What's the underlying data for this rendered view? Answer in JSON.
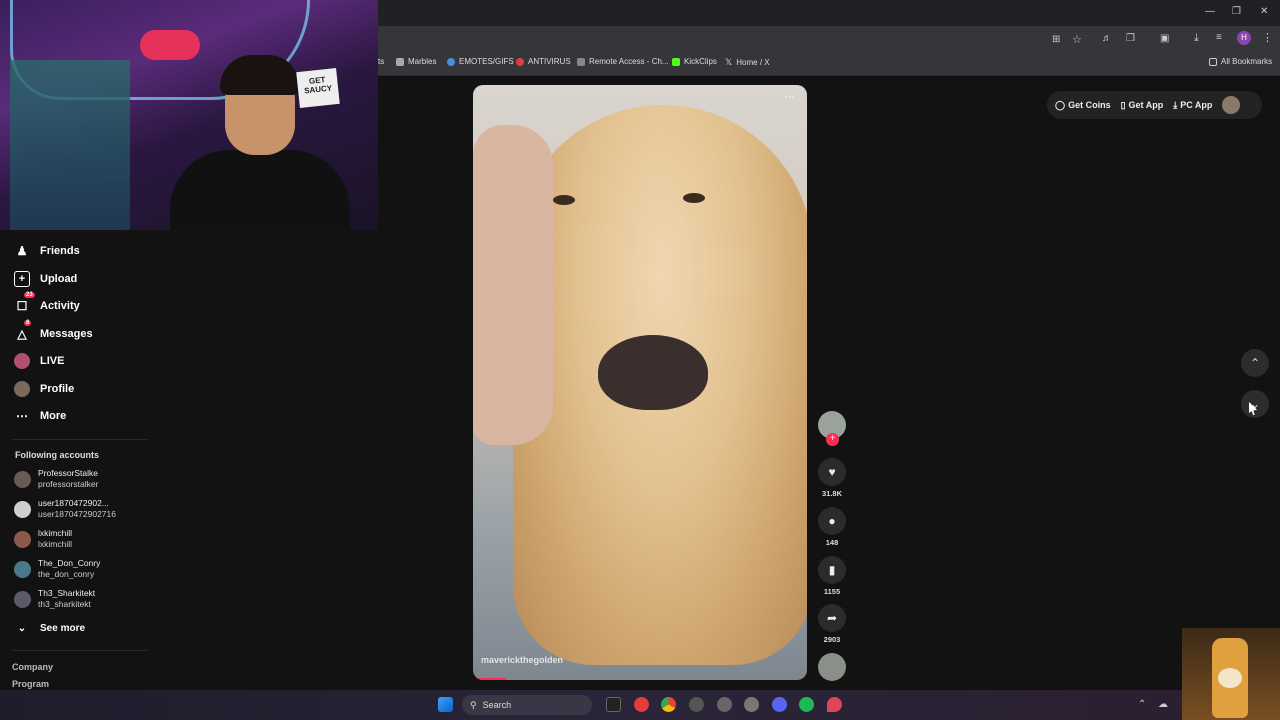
{
  "browser": {
    "bookmarks": [
      {
        "label": "ts",
        "color": "#777"
      },
      {
        "label": "Marbles",
        "color": "#aaa"
      },
      {
        "label": "EMOTES/GIFS",
        "color": "#4a90e2"
      },
      {
        "label": "ANTIVIRUS",
        "color": "#e23c3c"
      },
      {
        "label": "Remote Access - Ch...",
        "color": "#888"
      },
      {
        "label": "KickClips",
        "color": "#53fc18"
      },
      {
        "label": "Home / X",
        "color": "#ddd"
      }
    ],
    "all_bookmarks": "All Bookmarks",
    "profile_initial": "H"
  },
  "webcam": {
    "sign_text": "GET SAUCY"
  },
  "sidebar": {
    "nav": [
      {
        "label": "Friends",
        "icon": "friends-icon",
        "badge": ""
      },
      {
        "label": "Upload",
        "icon": "upload-icon",
        "badge": ""
      },
      {
        "label": "Activity",
        "icon": "activity-icon",
        "badge": "23"
      },
      {
        "label": "Messages",
        "icon": "messages-icon",
        "badge": "8"
      },
      {
        "label": "LIVE",
        "icon": "live-icon",
        "badge": ""
      },
      {
        "label": "Profile",
        "icon": "profile-icon",
        "badge": ""
      },
      {
        "label": "More",
        "icon": "more-icon",
        "badge": ""
      }
    ],
    "following_title": "Following accounts",
    "following": [
      {
        "name": "ProfessorStalke",
        "username": "professorstalker"
      },
      {
        "name": "user1870472902...",
        "username": "user1870472902716"
      },
      {
        "name": "lxkimchill",
        "username": "lxkimchill"
      },
      {
        "name": "The_Don_Conry",
        "username": "the_don_conry"
      },
      {
        "name": "Th3_Sharkitekt",
        "username": "th3_sharkitekt"
      }
    ],
    "see_more": "See more",
    "footer": [
      "Company",
      "Program"
    ]
  },
  "video": {
    "author": "maverickthegolden",
    "more": "···",
    "likes": "31.8K",
    "comments": "148",
    "saves": "1155",
    "shares": "2903",
    "progress": 0.1
  },
  "topbar": {
    "get_coins": "Get Coins",
    "get_app": "Get App",
    "pc_app": "PC App"
  },
  "taskbar": {
    "search_label": "Search"
  },
  "colors": {
    "accent": "#fe2c55",
    "background": "#121212"
  }
}
